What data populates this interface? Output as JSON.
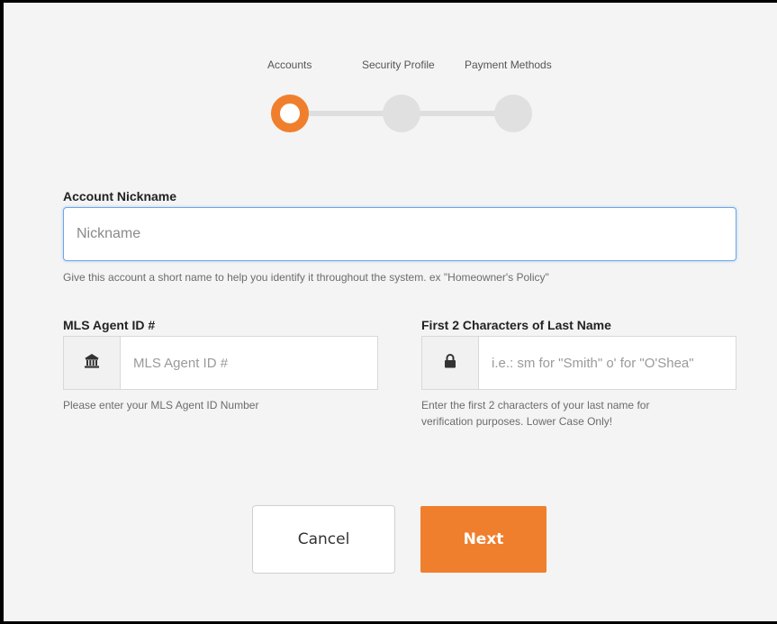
{
  "stepper": {
    "steps": [
      {
        "label": "Accounts",
        "state": "active"
      },
      {
        "label": "Security Profile",
        "state": "pending"
      },
      {
        "label": "Payment Methods",
        "state": "pending"
      }
    ],
    "accent_color": "#f07f2d"
  },
  "nickname": {
    "label": "Account Nickname",
    "placeholder": "Nickname",
    "value": "",
    "help": "Give this account a short name to help you identify it throughout the system. ex \"Homeowner's Policy\""
  },
  "mls": {
    "label": "MLS Agent ID #",
    "icon": "bank-icon",
    "placeholder": "MLS Agent ID #",
    "value": "",
    "help": "Please enter your MLS Agent ID Number"
  },
  "last_name": {
    "label": "First 2 Characters of Last Name",
    "icon": "lock-icon",
    "placeholder": "i.e.: sm for \"Smith\" o' for \"O'Shea\"",
    "value": "",
    "help_line1": "Enter the first 2 characters of your last name for",
    "help_line2": "verification purposes. Lower Case Only!"
  },
  "actions": {
    "cancel_label": "Cancel",
    "next_label": "Next"
  }
}
